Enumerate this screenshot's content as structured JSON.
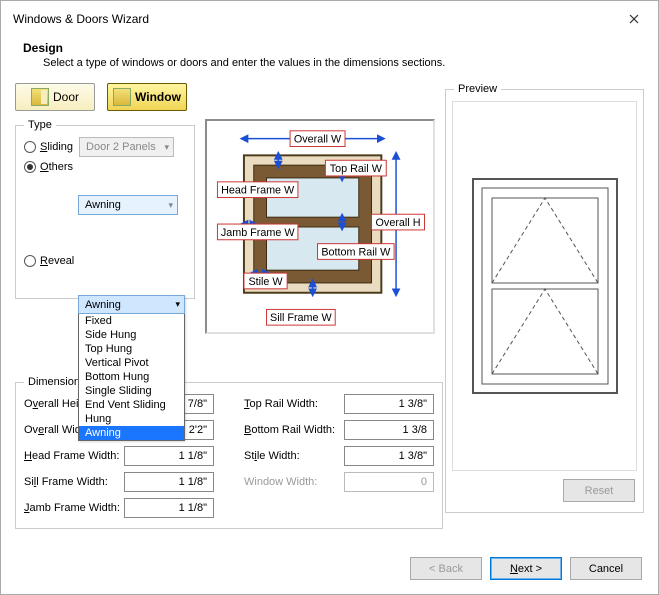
{
  "title": "Windows & Doors Wizard",
  "header": {
    "title": "Design",
    "desc": "Select a type of windows or doors and enter the values in the dimensions sections."
  },
  "toggles": {
    "door": "Door",
    "window": "Window"
  },
  "type": {
    "legend": "Type",
    "sliding": "Sliding",
    "others": "Others",
    "reveal": "Reveal",
    "combo1": "Door 2 Panels",
    "combo2": "Awning",
    "options": [
      "Fixed",
      "Side Hung",
      "Top Hung",
      "Vertical Pivot",
      "Bottom Hung",
      "Single Sliding",
      "End Vent Sliding",
      "Hung",
      "Awning"
    ],
    "selected": "Awning"
  },
  "diagram": {
    "overall_w": "Overall W",
    "overall_h": "Overall H",
    "top_rail": "Top Rail W",
    "head_frame": "Head Frame W",
    "jamb_frame": "Jamb Frame W",
    "bottom_rail": "Bottom Rail W",
    "stile": "Stile W",
    "sill_frame": "Sill Frame W"
  },
  "dims": {
    "legend": "Dimensions",
    "overall_h": {
      "label": "Overall Height:",
      "val": "2'5 7/8\""
    },
    "overall_w": {
      "label": "Overall Width:",
      "val": "2'2\""
    },
    "head_frame": {
      "label": "Head Frame Width:",
      "val": "1 1/8\""
    },
    "sill_frame": {
      "label": "Sill Frame Width:",
      "val": "1 1/8\""
    },
    "jamb_frame": {
      "label": "Jamb Frame Width:",
      "val": "1 1/8\""
    },
    "top_rail": {
      "label": "Top Rail Width:",
      "val": "1 3/8\""
    },
    "bottom_rail": {
      "label": "Bottom Rail Width:",
      "val": "1 3/8"
    },
    "stile": {
      "label": "Stile Width:",
      "val": "1 3/8\""
    },
    "window_w": {
      "label": "Window Width:",
      "val": "0"
    }
  },
  "preview": {
    "legend": "Preview",
    "reset": "Reset"
  },
  "footer": {
    "back": "< Back",
    "next": "Next >",
    "cancel": "Cancel"
  }
}
